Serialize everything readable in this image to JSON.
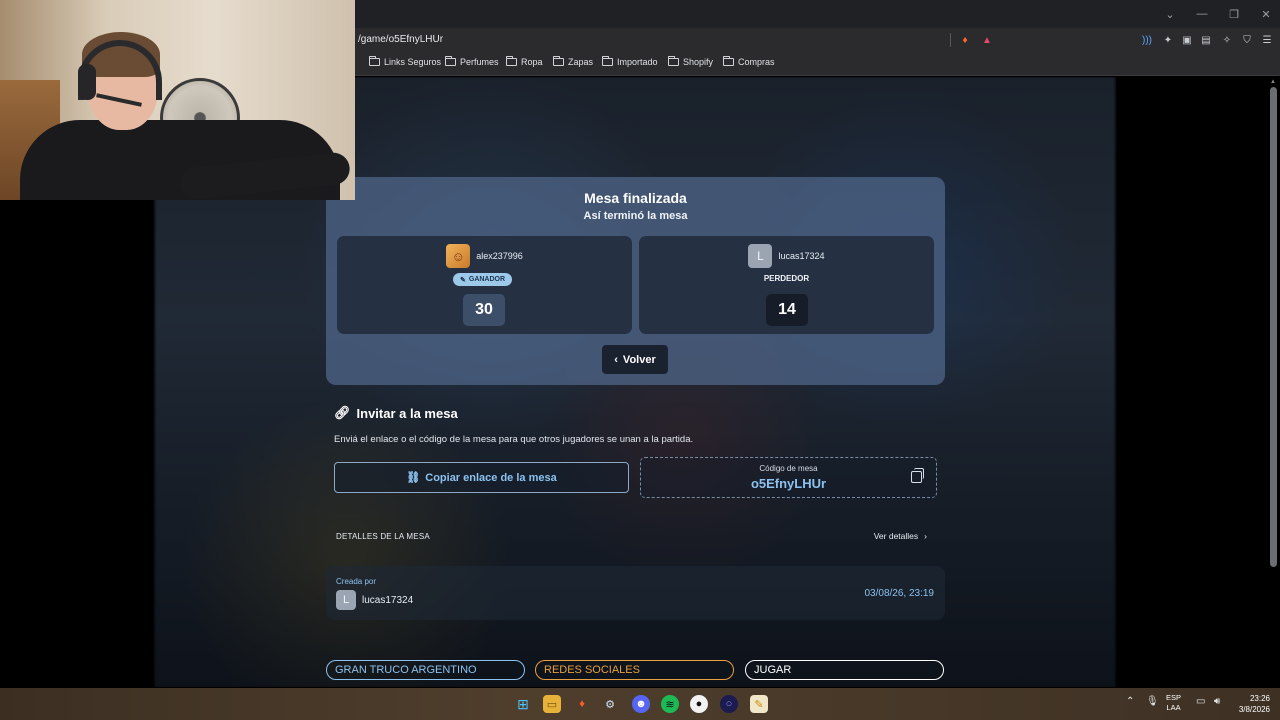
{
  "browser": {
    "url": "/game/o5EfnyLHUr",
    "bookmarks": [
      "Links Seguros",
      "Perfumes",
      "Ropa",
      "Zapas",
      "Importado",
      "Shopify",
      "Compras"
    ]
  },
  "result": {
    "title": "Mesa finalizada",
    "subtitle": "Así terminó la mesa",
    "winner": {
      "username": "alex237996",
      "badge": "GANADOR",
      "score": "30"
    },
    "loser": {
      "username": "lucas17324",
      "initial": "L",
      "badge": "PERDEDOR",
      "score": "14"
    },
    "back_label": "Volver"
  },
  "invite": {
    "title": "Invitar a la mesa",
    "description": "Enviá el enlace o el código de la mesa para que otros jugadores se unan a la partida.",
    "copy_link_label": "Copiar enlace de la mesa",
    "code_label": "Código de mesa",
    "code_value": "o5EfnyLHUr"
  },
  "details": {
    "label": "DETALLES DE LA MESA",
    "link": "Ver detalles",
    "created_by_label": "Creada por",
    "creator_initial": "L",
    "creator": "lucas17324",
    "created_at": "03/08/26, 23:19"
  },
  "footer": {
    "items": [
      "GRAN TRUCO ARGENTINO",
      "REDES SOCIALES",
      "JUGAR"
    ]
  },
  "taskbar": {
    "lang_top": "ESP",
    "lang_bottom": "LAA",
    "time": "23:26",
    "date": "3/8/2026"
  },
  "colors": {
    "accent": "#8cc2ef",
    "winner_badge": "#9cc8ea",
    "card": "#50688c",
    "footer_orange": "#e8a040",
    "footer_blue": "#8cc2ef"
  }
}
